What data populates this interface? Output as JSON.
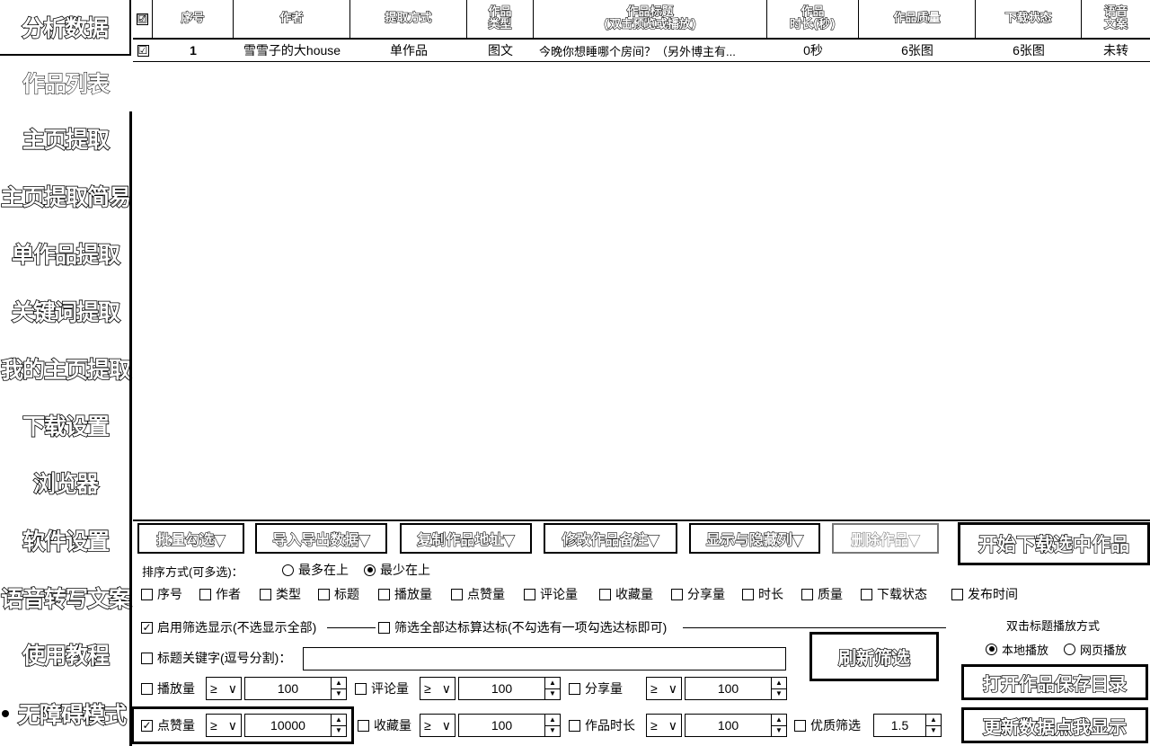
{
  "sidebar": {
    "items": [
      {
        "label": "分析数据"
      },
      {
        "label": "作品列表"
      },
      {
        "label": "主页提取"
      },
      {
        "label": "主页提取简易"
      },
      {
        "label": "单作品提取"
      },
      {
        "label": "关键词提取"
      },
      {
        "label": "我的主页提取"
      },
      {
        "label": "下载设置"
      },
      {
        "label": "浏览器"
      },
      {
        "label": "软件设置"
      },
      {
        "label": "语音转写文案"
      },
      {
        "label": "使用教程"
      },
      {
        "label": "无障碍模式"
      }
    ],
    "active_item": "作品列表"
  },
  "table": {
    "header_checkbox": "☑",
    "columns": [
      {
        "l1": "序号",
        "l2": ""
      },
      {
        "l1": "作者",
        "l2": ""
      },
      {
        "l1": "提取方式",
        "l2": ""
      },
      {
        "l1": "作品",
        "l2": "类型"
      },
      {
        "l1": "作品标题",
        "l2": "(双击预览或播放)"
      },
      {
        "l1": "作品",
        "l2": "时长(秒)"
      },
      {
        "l1": "作品质量",
        "l2": ""
      },
      {
        "l1": "下载状态",
        "l2": ""
      },
      {
        "l1": "语音",
        "l2": "文案"
      }
    ],
    "rows": [
      {
        "checked": "☑",
        "index": "1",
        "author": "雪雪子的大house",
        "method": "单作品",
        "type": "图文",
        "title": "今晚你想睡哪个房间？（另外博主有...",
        "duration": "0秒",
        "quality": "6张图",
        "status": "6张图",
        "transcript": "未转"
      }
    ]
  },
  "toolbar": {
    "batch_select": "批量勾选▼",
    "import_export": "导入导出数据▼",
    "copy_url": "复制作品地址▼",
    "edit_note": "修改作品备注▼",
    "show_hide_cols": "显示与隐藏列▼",
    "delete_works": "删除作品▼",
    "start_download": "开始下载选中作品"
  },
  "sort": {
    "label": "排序方式(可多选)：",
    "most_top": "最多在上",
    "least_top": "最少在上",
    "selected": "最少在上",
    "fields": [
      "序号",
      "作者",
      "类型",
      "标题",
      "播放量",
      "点赞量",
      "评论量",
      "收藏量",
      "分享量",
      "时长",
      "质量",
      "下载状态",
      "发布时间"
    ]
  },
  "filter": {
    "enable_label": "启用筛选显示(不选显示全部)",
    "enable_checked": true,
    "all_reach_label": "筛选全部达标算达标(不勾选有一项勾选达标即可)",
    "keyword_label": "标题关键字(逗号分割)：",
    "keyword_value": "",
    "refresh": "刷新筛选",
    "play_label": "播放量",
    "comment_label": "评论量",
    "share_label": "分享量",
    "like_label": "点赞量",
    "collect_label": "收藏量",
    "duration_label": "作品时长",
    "quality_label": "优质筛选",
    "op": "≥",
    "play_value": "100",
    "comment_value": "100",
    "share_value": "100",
    "like_value": "10000",
    "collect_value": "100",
    "duration_value": "100",
    "quality_value": "1.5"
  },
  "playmode": {
    "title": "双击标题播放方式",
    "local": "本地播放",
    "web": "网页播放",
    "selected": "本地播放"
  },
  "actions": {
    "open_folder": "打开作品保存目录",
    "update_data": "更新数据点我显示"
  }
}
